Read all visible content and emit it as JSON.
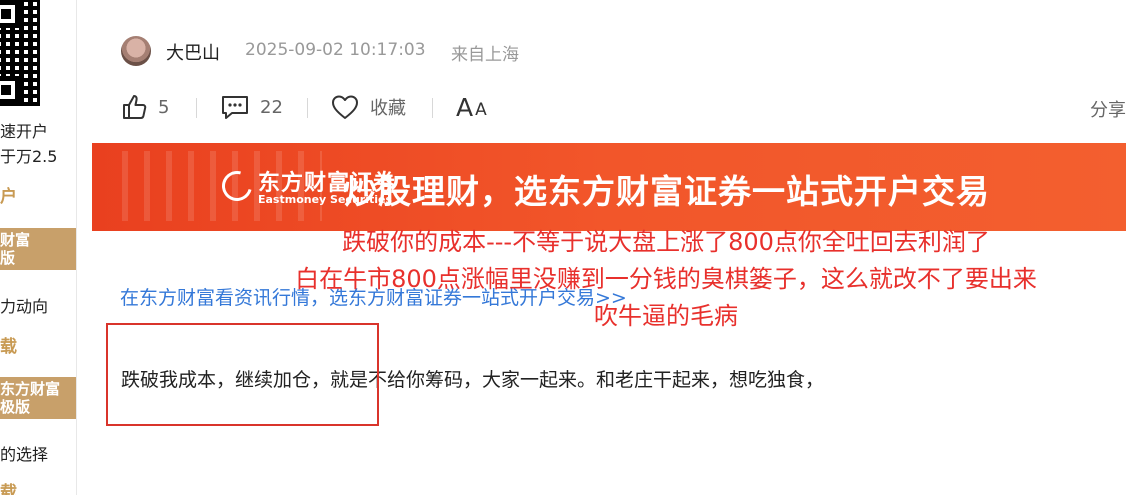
{
  "sidebar": {
    "line1": "速开户",
    "line2": "于万2.5",
    "link1": "户",
    "badge1": [
      "财富",
      "版"
    ],
    "line3": "力动向",
    "link2": "载",
    "badge2": [
      "东方财富",
      "极版"
    ],
    "line4": "的选择",
    "link3": "载"
  },
  "post": {
    "author": "大巴山",
    "datetime": "2025-09-02 10:17:03",
    "location": "来自上海",
    "body": "跌破我成本，继续加仓，就是不给你筹码，大家一起来。和老庄干起来，想吃独食，"
  },
  "toolbar": {
    "like_count": "5",
    "comment_count": "22",
    "favorite_label": "收藏",
    "font_label_big": "A",
    "font_label_small": "A",
    "share_label": "分享"
  },
  "banner": {
    "logo_cn": "东方财富证券",
    "logo_en": "Eastmoney Securities",
    "slogan": "炒股理财，选东方财富证券一站式开户交易"
  },
  "info_link": "在东方财富看资讯行情，选东方财富证券一站式开户交易>>",
  "annotation": {
    "lines": [
      "跌破你的成本---不等于说大盘上涨了800点你全吐回去利润了",
      "白在牛市800点涨幅里没赚到一分钱的臭棋篓子，这么就改不了要出来",
      "吹牛逼的毛病"
    ]
  },
  "colors": {
    "accent_red": "#e8302c",
    "banner_orange": "#f2562a",
    "link_blue": "#3478d8",
    "gold": "#c89a53"
  }
}
